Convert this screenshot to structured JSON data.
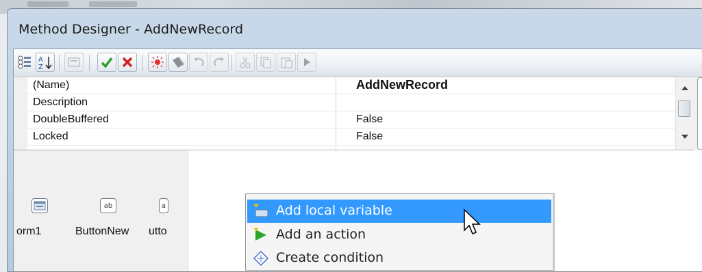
{
  "window": {
    "title": "Method Designer - AddNewRecord"
  },
  "toolbar": {
    "icons": [
      "categorized-icon",
      "alphabetical-sort-icon",
      "property-pages-icon",
      "accept-check-icon",
      "cancel-x-icon",
      "debug-bug-icon",
      "wand-icon",
      "undo-icon",
      "redo-icon",
      "cut-icon",
      "copy-icon",
      "paste-icon",
      "run-icon"
    ]
  },
  "properties": {
    "rows": [
      {
        "name": "(Name)",
        "value": "AddNewRecord"
      },
      {
        "name": "Description",
        "value": ""
      },
      {
        "name": "DoubleBuffered",
        "value": "False"
      },
      {
        "name": "Locked",
        "value": "False"
      }
    ]
  },
  "components": [
    {
      "label": "orm1",
      "icon_text": ""
    },
    {
      "label": "ButtonNew",
      "icon_text": "ab"
    },
    {
      "label": "utto",
      "icon_text": "a"
    }
  ],
  "context_menu": {
    "items": [
      {
        "label": "Add local variable",
        "icon": "local-variable-icon",
        "highlighted": true
      },
      {
        "label": "Add an action",
        "icon": "action-arrow-icon",
        "highlighted": false
      },
      {
        "label": "Create condition",
        "icon": "condition-diamond-icon",
        "highlighted": false
      }
    ]
  },
  "colors": {
    "highlight": "#3399ff",
    "accept": "#2e9e2e",
    "cancel": "#d42020"
  }
}
